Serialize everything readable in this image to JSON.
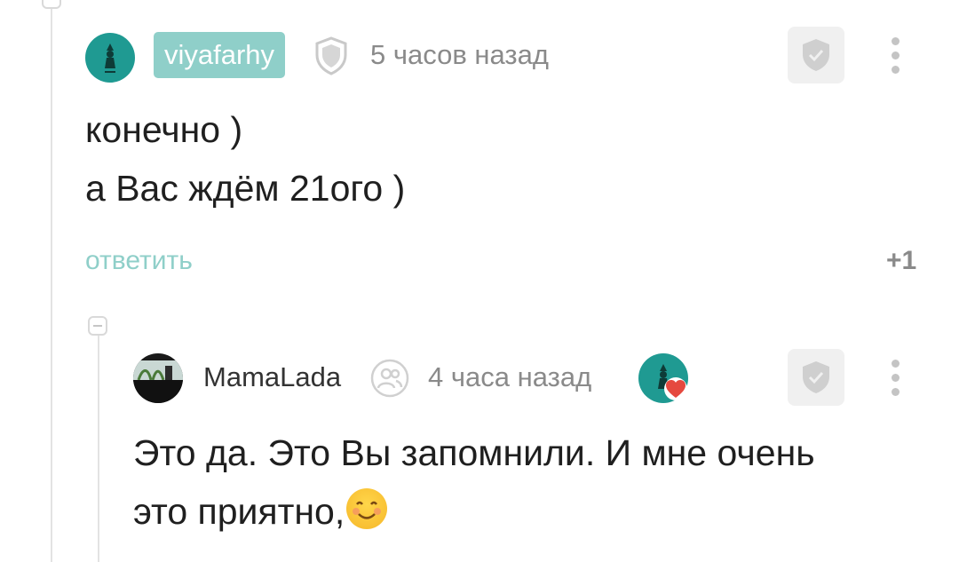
{
  "comment1": {
    "username": "viyafarhy",
    "time": "5 часов назад",
    "text_lines": [
      "конечно )",
      "а Вас ждём 21ого )"
    ],
    "reply_label": "ответить",
    "rating": "+1"
  },
  "comment2": {
    "username": "MamaLada",
    "time": "4 часа назад",
    "text_lines": [
      "Это да. Это Вы запомнили. И мне очень",
      "это приятно,"
    ],
    "emoji": "smiling-face"
  },
  "colors": {
    "accent": "#8fcfc9",
    "teal_avatar": "#1f9a92",
    "heart": "#e5493f",
    "muted": "#8a8a8a"
  }
}
